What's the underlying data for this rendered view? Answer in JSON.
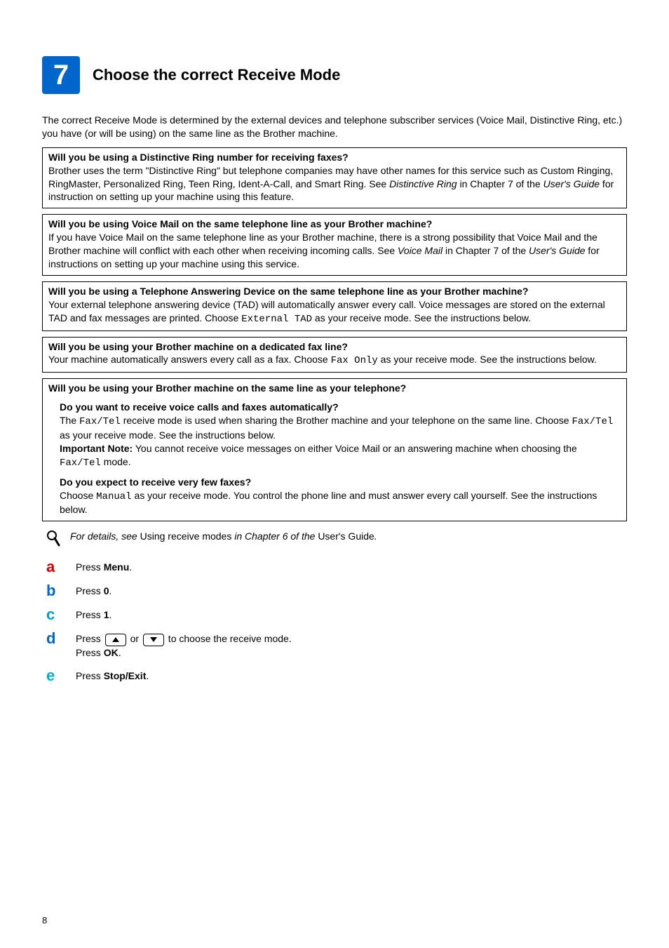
{
  "page_number": "8",
  "header": {
    "step_number": "7",
    "title": "Choose the correct Receive Mode"
  },
  "intro": "The correct Receive Mode is determined by the external devices and telephone subscriber services (Voice Mail, Distinctive Ring, etc.) you have (or will be using) on the same line as the Brother machine.",
  "box1": {
    "q": "Will you be using a Distinctive Ring number for receiving faxes?",
    "body_a": "Brother uses the term \"Distinctive Ring\" but telephone companies may have other names for this service such as Custom Ringing, RingMaster, Personalized Ring, Teen Ring, Ident-A-Call, and Smart Ring. See ",
    "body_italic_a": "Distinctive Ring",
    "body_b": " in Chapter 7 of the ",
    "body_italic_b": "User's Guide",
    "body_c": " for instruction on setting up your machine using this feature."
  },
  "box2": {
    "q": "Will you be using Voice Mail on the same telephone line as your Brother machine?",
    "body_a": "If you have Voice Mail on the same telephone line as your Brother machine, there is a strong possibility that Voice Mail and the Brother machine will conflict with each other when receiving incoming calls. See ",
    "body_italic_a": "Voice Mail",
    "body_b": " in Chapter 7 of the ",
    "body_italic_b": "User's Guide",
    "body_c": " for instructions on setting up your machine using this service."
  },
  "box3": {
    "q": "Will you be using a Telephone Answering Device on the same telephone line as your Brother machine?",
    "body_a": "Your external telephone answering device (TAD) will automatically answer every call. Voice messages are stored on the external TAD and fax messages are printed. Choose ",
    "mono_a": "External TAD",
    "body_b": " as your receive mode. See the instructions below."
  },
  "box4": {
    "q": "Will you be using your Brother machine on a dedicated fax line?",
    "body_a": "Your machine automatically answers every call as a fax. Choose ",
    "mono_a": "Fax Only",
    "body_b": " as your receive mode. See the instructions below."
  },
  "box5": {
    "q": "Will you be using your Brother machine on the same line as your telephone?",
    "sub1_q": "Do you want to receive voice calls and faxes automatically?",
    "sub1_a": "The ",
    "sub1_mono_a": "Fax/Tel",
    "sub1_b": " receive mode is used when sharing the Brother machine and your telephone on the same line. Choose ",
    "sub1_mono_b": "Fax/Tel",
    "sub1_c": " as your receive mode. See the instructions below.",
    "sub1_note_label": "Important Note:",
    "sub1_note_a": " You cannot receive voice messages on either Voice Mail or an answering machine when choosing the ",
    "sub1_note_mono": "Fax/Tel",
    "sub1_note_b": " mode.",
    "sub2_q": "Do you expect to receive very few faxes?",
    "sub2_a": "Choose ",
    "sub2_mono": "Manual",
    "sub2_b": " as your receive mode. You control the phone line and must answer every call yourself. See the instructions below."
  },
  "tip": {
    "pre": "For details, see ",
    "non_italic_a": "Using receive modes",
    "mid": " in Chapter 6 of the ",
    "non_italic_b": "User's Guide",
    "post": "."
  },
  "steps": {
    "a_pre": "Press ",
    "a_bold": "Menu",
    "a_post": ".",
    "b_pre": "Press ",
    "b_bold": "0",
    "b_post": ".",
    "c_pre": "Press ",
    "c_bold": "1",
    "c_post": ".",
    "d_pre": "Press ",
    "d_or": " or ",
    "d_mid": " to choose the receive mode.",
    "d_line2_pre": "Press ",
    "d_line2_bold": "OK",
    "d_line2_post": ".",
    "e_pre": "Press ",
    "e_bold": "Stop/Exit",
    "e_post": "."
  }
}
